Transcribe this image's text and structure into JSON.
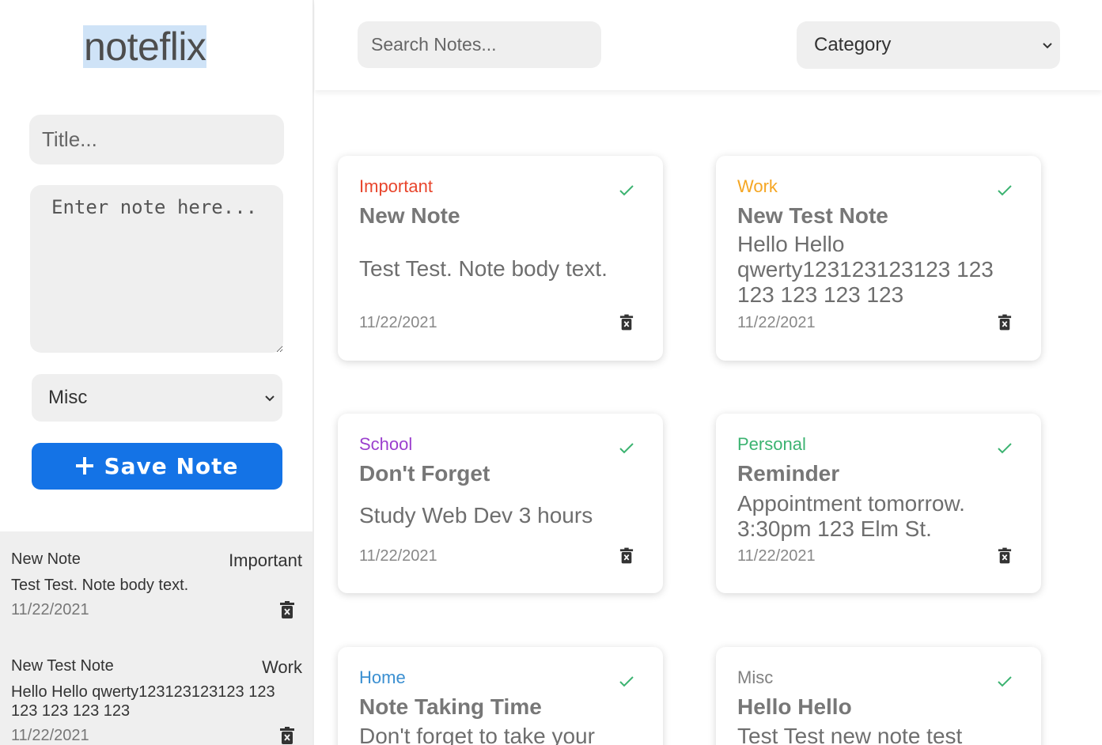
{
  "app": {
    "logo": "noteflix"
  },
  "editor": {
    "title_placeholder": "Title...",
    "body_placeholder": "Enter note here...",
    "category_value": "Misc",
    "save_label": "Save Note"
  },
  "header": {
    "search_placeholder": "Search Notes...",
    "category_filter_value": "Category"
  },
  "sidebar_notes": [
    {
      "title": "New Note",
      "category": "Important",
      "body": "Test Test. Note body text.",
      "date": "11/22/2021"
    },
    {
      "title": "New Test Note",
      "category": "Work",
      "body": "Hello Hello qwerty123123123123 123 123 123 123 123",
      "date": "11/22/2021"
    }
  ],
  "cards": [
    {
      "category": "Important",
      "category_color": "#e8452c",
      "title": "New Note",
      "body": "Test Test. Note body text.",
      "date": "11/22/2021"
    },
    {
      "category": "Work",
      "category_color": "#f5a623",
      "title": "New Test Note",
      "body": "Hello Hello qwerty123123123123 123 123 123 123 123",
      "date": "11/22/2021"
    },
    {
      "category": "School",
      "category_color": "#9b3fce",
      "title": "Don't Forget",
      "body": "Study Web Dev 3 hours",
      "date": "11/22/2021"
    },
    {
      "category": "Personal",
      "category_color": "#3cb371",
      "title": "Reminder",
      "body": "Appointment tomorrow. 3:30pm 123 Elm St.",
      "date": "11/22/2021"
    },
    {
      "category": "Home",
      "category_color": "#3a8fd1",
      "title": "Note Taking Time",
      "body": "Don't forget to take your"
    },
    {
      "category": "Misc",
      "category_color": "#808080",
      "title": "Hello Hello",
      "body": "Test Test new note test"
    }
  ],
  "icons": {
    "check": "check-icon",
    "trash": "trash-icon",
    "plus": "plus-icon",
    "dropdown": "chevron-down-icon"
  },
  "colors": {
    "accent": "#1473e6",
    "check": "#3cb371",
    "input_bg": "#efefef"
  }
}
